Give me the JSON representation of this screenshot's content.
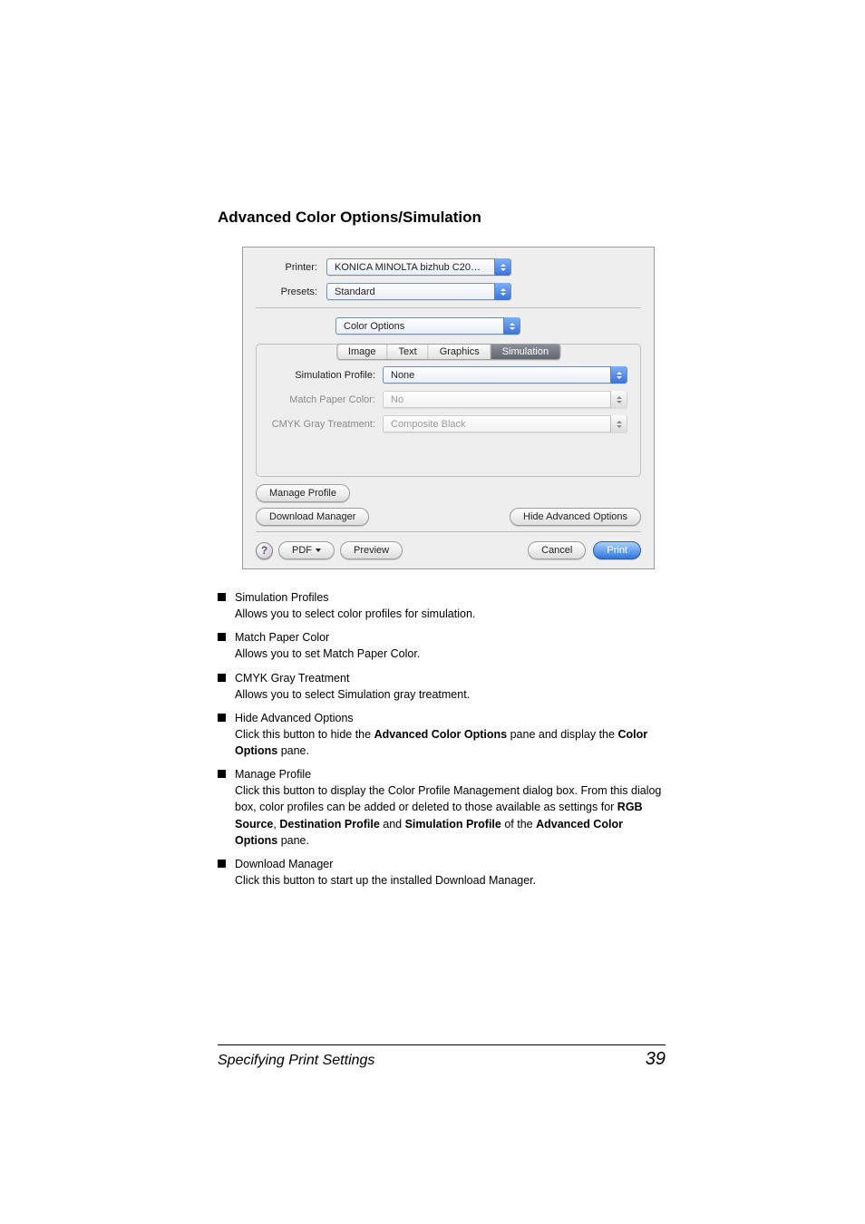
{
  "heading": "Advanced Color Options/Simulation",
  "dialog": {
    "printer_label": "Printer:",
    "printer_value": "KONICA MINOLTA bizhub C20…",
    "presets_label": "Presets:",
    "presets_value": "Standard",
    "section_value": "Color Options",
    "tabs": {
      "image": "Image",
      "text": "Text",
      "graphics": "Graphics",
      "simulation": "Simulation"
    },
    "opts": {
      "sim_profile_label": "Simulation Profile:",
      "sim_profile_value": "None",
      "match_paper_label": "Match Paper Color:",
      "match_paper_value": "No",
      "cmyk_gray_label": "CMYK Gray Treatment:",
      "cmyk_gray_value": "Composite Black"
    },
    "buttons": {
      "manage_profile": "Manage Profile",
      "download_manager": "Download Manager",
      "hide_advanced": "Hide Advanced Options",
      "help": "?",
      "pdf": "PDF",
      "preview": "Preview",
      "cancel": "Cancel",
      "print": "Print"
    }
  },
  "bullets": {
    "sim_profiles_title": "Simulation Profiles",
    "sim_profiles_body": "Allows you to select color profiles for simulation.",
    "match_paper_title": "Match Paper Color",
    "match_paper_body": "Allows you to set Match Paper Color.",
    "cmyk_title": "CMYK Gray Treatment",
    "cmyk_body": "Allows you to select Simulation gray treatment.",
    "hide_title": "Hide Advanced Options",
    "hide_body_pre": "Click this button to hide the ",
    "hide_body_b1": "Advanced Color Options",
    "hide_body_mid": " pane and display the ",
    "hide_body_b2": "Color Options",
    "hide_body_post": " pane.",
    "manage_title": "Manage Profile",
    "manage_body_l1": "Click this button to display the Color Profile Management dialog box. From this dialog box, color profiles can be added or deleted to those available as settings for ",
    "manage_b1": "RGB Source",
    "manage_body_sep1": ", ",
    "manage_b2": "Destination Profile",
    "manage_body_sep2": " and ",
    "manage_b3": "Simulation Profile",
    "manage_body_sep3": " of the ",
    "manage_b4": "Advanced Color Options",
    "manage_body_end": " pane.",
    "dl_title": "Download Manager",
    "dl_body": "Click this button to start up the installed Download Manager."
  },
  "footer": {
    "title": "Specifying Print Settings",
    "page": "39"
  }
}
